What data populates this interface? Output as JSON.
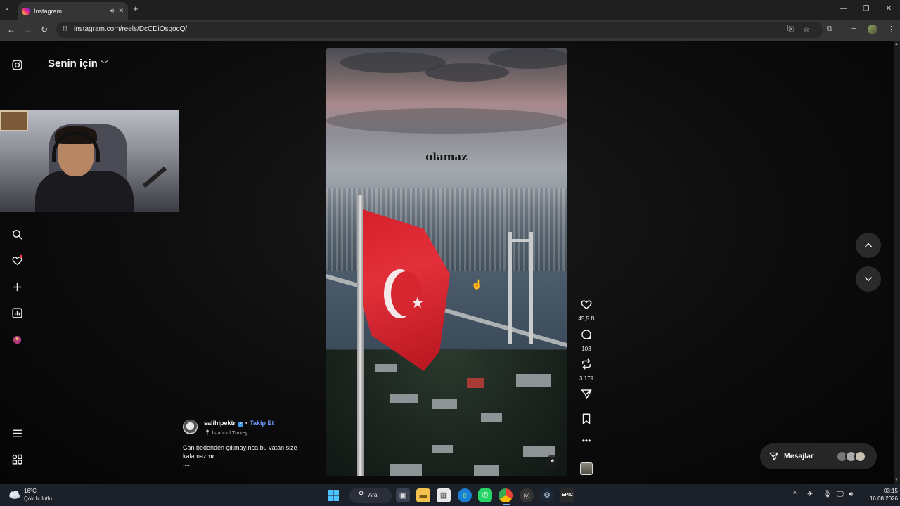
{
  "browser": {
    "tab_title": "Instagram",
    "url": "instagram.com/reels/DcCDiOsqocQ/"
  },
  "sidebar": {
    "feed_title": "Senin için",
    "icons": [
      "instagram-logo",
      "search-icon",
      "heart-icon",
      "create-icon",
      "insights-icon",
      "profile-avatar",
      "menu-icon",
      "more-apps-icon"
    ]
  },
  "reel": {
    "overlay_text": "olamaz"
  },
  "actions": {
    "likes": "45,5 B",
    "comments": "103",
    "reposts": "3.179"
  },
  "post": {
    "username": "salihipektr",
    "follow_label": "Takip Et",
    "location": "İstanbul Turkey",
    "caption": "Can bedenden çıkmayınca bu vatan size kalamaz.",
    "caption_suffix": "TR",
    "more": "...."
  },
  "messages": {
    "label": "Mesajlar"
  },
  "taskbar": {
    "temperature": "16°C",
    "weather": "Çok bulutlu",
    "search_label": "Ara",
    "time": "03:15",
    "date": "16.08.2026"
  },
  "colors": {
    "accent_link": "#6b9bff",
    "verified": "#3897f0",
    "flag_red": "#d4202a"
  }
}
